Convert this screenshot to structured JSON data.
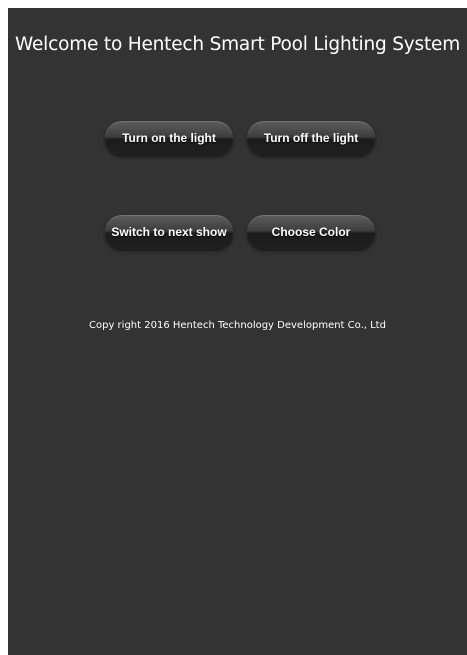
{
  "header": {
    "title": "Welcome to Hentech Smart Pool Lighting System"
  },
  "controls": {
    "turn_on_label": "Turn on the light",
    "turn_off_label": "Turn off the light",
    "next_show_label": "Switch to next show",
    "choose_color_label": "Choose Color"
  },
  "footer": {
    "copyright": "Copy right 2016 Hentech Technology Development Co., Ltd"
  },
  "colors": {
    "background": "#333333",
    "text": "#ffffff"
  }
}
